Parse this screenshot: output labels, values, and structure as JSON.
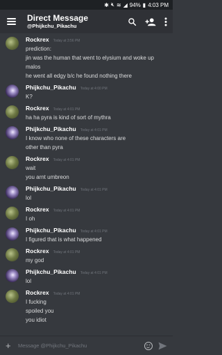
{
  "status_bar": {
    "battery": "94%",
    "time": "4:03 PM"
  },
  "header": {
    "title": "Direct Message",
    "subtitle": "@Phijkchu_Pikachu"
  },
  "messages": [
    {
      "author": "Rockrex",
      "avatar": "rockrex",
      "time": "Today at 3:56 PM",
      "lines": [
        "prediction:",
        "jin was the human that went to elysium and woke up",
        "malos",
        "he went all edgy b/c he found nothing there"
      ]
    },
    {
      "author": "Phijkchu_Pikachu",
      "avatar": "pikachu",
      "time": "Today at 4:00 PM",
      "lines": [
        "K?"
      ]
    },
    {
      "author": "Rockrex",
      "avatar": "rockrex",
      "time": "Today at 4:01 PM",
      "lines": [
        "ha ha pyra is kind of sort of mythra"
      ]
    },
    {
      "author": "Phijkchu_Pikachu",
      "avatar": "pikachu",
      "time": "Today at 4:01 PM",
      "lines": [
        "I know who none of these characters are",
        "other than pyra"
      ]
    },
    {
      "author": "Rockrex",
      "avatar": "rockrex",
      "time": "Today at 4:01 PM",
      "lines": [
        "wait",
        "you arnt umbreon"
      ]
    },
    {
      "author": "Phijkchu_Pikachu",
      "avatar": "pikachu",
      "time": "Today at 4:01 PM",
      "lines": [
        "lol"
      ]
    },
    {
      "author": "Rockrex",
      "avatar": "rockrex",
      "time": "Today at 4:01 PM",
      "lines": [
        "I oh"
      ]
    },
    {
      "author": "Phijkchu_Pikachu",
      "avatar": "pikachu",
      "time": "Today at 4:01 PM",
      "lines": [
        "I figured that is what happened"
      ]
    },
    {
      "author": "Rockrex",
      "avatar": "rockrex",
      "time": "Today at 4:01 PM",
      "lines": [
        "my god"
      ]
    },
    {
      "author": "Phijkchu_Pikachu",
      "avatar": "pikachu",
      "time": "Today at 4:01 PM",
      "lines": [
        "lol"
      ]
    },
    {
      "author": "Rockrex",
      "avatar": "rockrex",
      "time": "Today at 4:01 PM",
      "lines": [
        "I fucking",
        "spoiled you",
        "you idiot"
      ]
    }
  ],
  "composer": {
    "placeholder": "Message @Phijkchu_Pikachu"
  },
  "icons": {
    "menu": "hamburger-icon",
    "search": "search-icon",
    "add_friend": "add-person-icon",
    "more": "kebab-menu-icon",
    "attach": "plus-icon",
    "emoji": "emoji-icon",
    "send": "send-icon"
  },
  "colors": {
    "background": "#36393e",
    "header": "#2f3136",
    "status_bar": "#1e2124",
    "text": "#dcddde",
    "muted": "#72767d"
  }
}
